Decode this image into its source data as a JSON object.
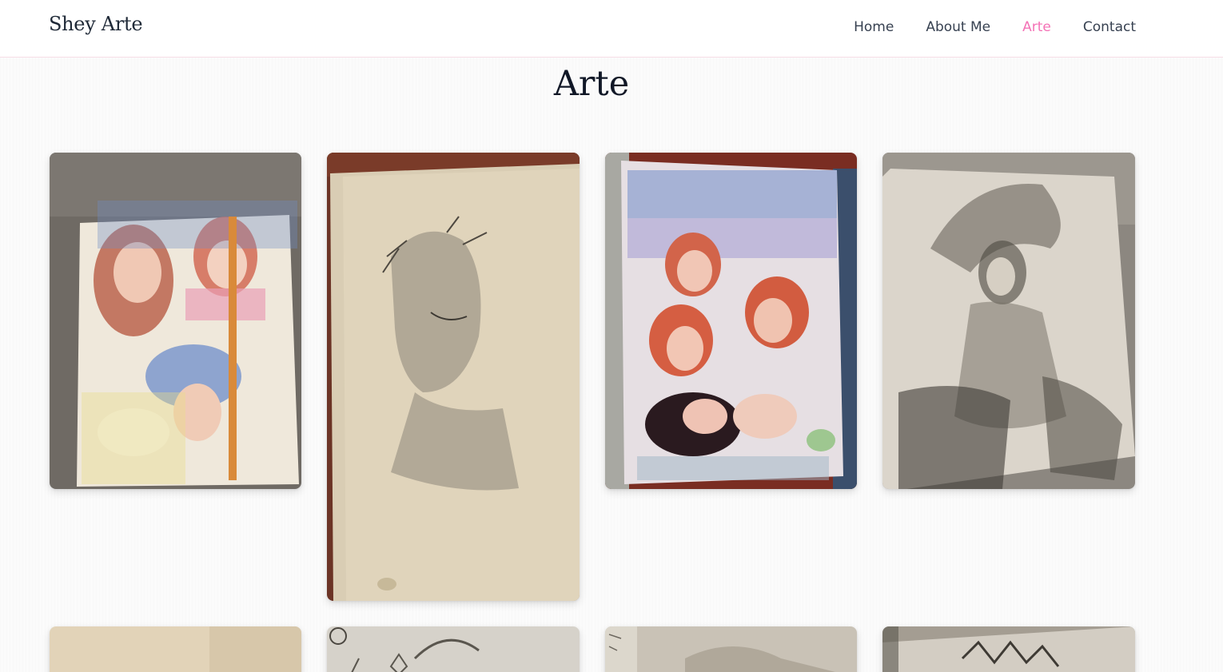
{
  "nav": {
    "brand": "Shey Arte",
    "links": [
      {
        "label": "Home",
        "active": false
      },
      {
        "label": "About Me",
        "active": false
      },
      {
        "label": "Arte",
        "active": true
      },
      {
        "label": "Contact",
        "active": false
      }
    ]
  },
  "page": {
    "title": "Arte"
  },
  "colors": {
    "accent": "#f472b6",
    "nav_text": "#374151",
    "title_text": "#111827"
  }
}
